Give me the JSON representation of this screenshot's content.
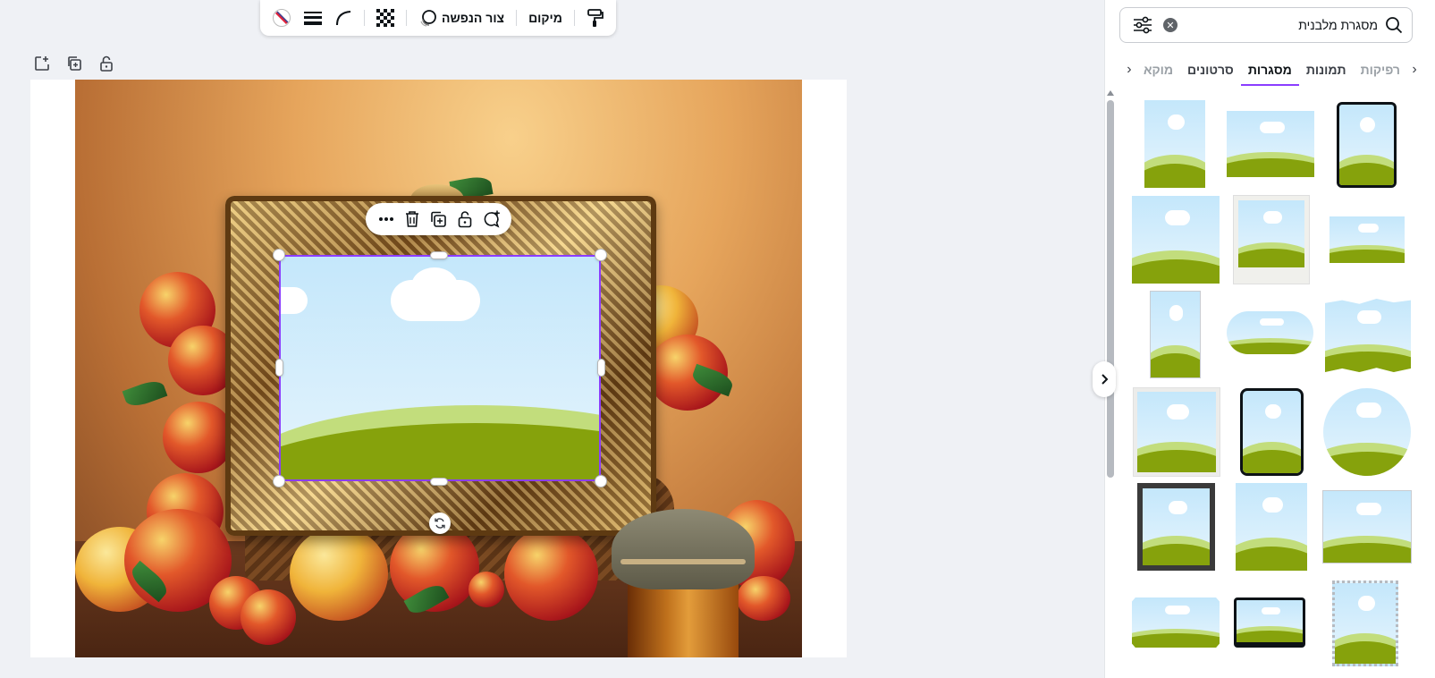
{
  "toolbar": {
    "position_label": "מיקום",
    "mask_label": "צור הנפשה",
    "icons": [
      "paint-format-icon",
      "animate-icon",
      "transparency-icon",
      "corner-rounding-icon",
      "border-weight-icon",
      "border-color-icon"
    ]
  },
  "page_actions": [
    "add-page-icon",
    "duplicate-page-icon",
    "lock-page-icon"
  ],
  "floating_bar": [
    "more-icon",
    "delete-icon",
    "duplicate-icon",
    "lock-icon",
    "comment-icon"
  ],
  "panel": {
    "search": {
      "value": "מסגרת מלבנית",
      "placeholder": ""
    },
    "tabs": [
      {
        "label": "רפיקות",
        "active": false,
        "faded": true
      },
      {
        "label": "תמונות",
        "active": false
      },
      {
        "label": "מסגרות",
        "active": true
      },
      {
        "label": "סרטונים",
        "active": false
      },
      {
        "label": "מוקא",
        "active": false,
        "faded": true
      }
    ]
  },
  "colors": {
    "accent": "#8b3dff",
    "sky": "#c4e7fb",
    "hill_light": "#c2dd7c",
    "hill_dark": "#86a20c"
  }
}
